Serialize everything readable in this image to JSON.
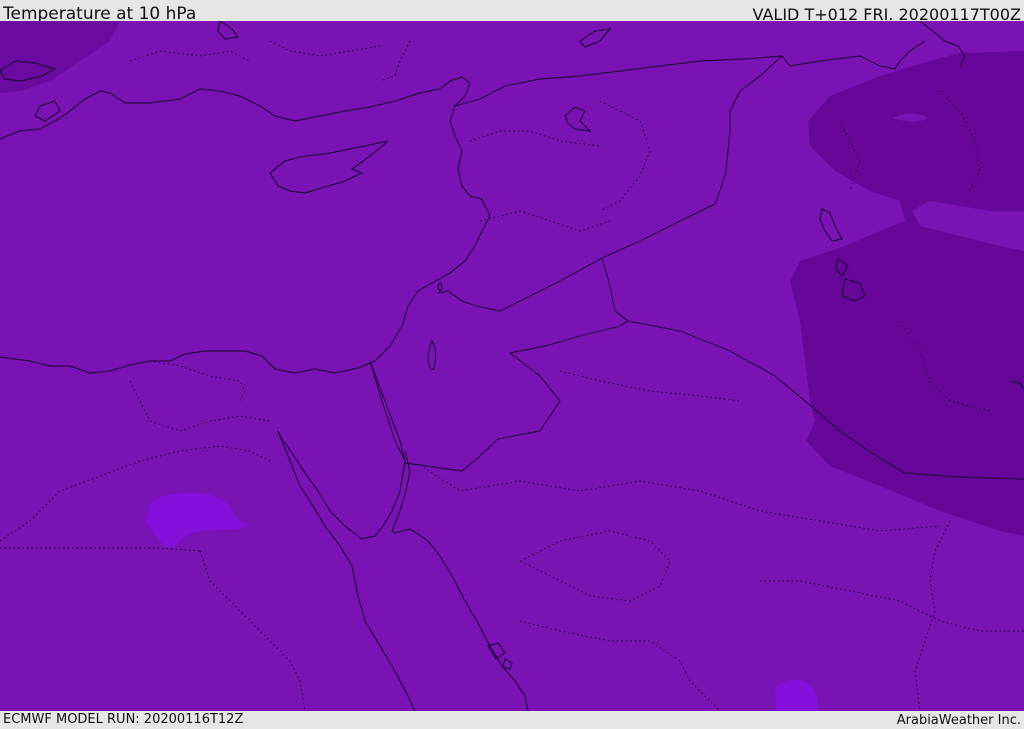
{
  "header": {
    "title": "Temperature at 10 hPa",
    "valid_time": "VALID T+012 FRI. 20200117T00Z"
  },
  "footer": {
    "model_run": "ECMWF MODEL RUN: 20200116T12Z",
    "credit": "ArabiaWeather Inc."
  },
  "map": {
    "field": "temperature",
    "level": "10 hPa",
    "colors": {
      "base": "#7a13b4",
      "cold_region": "#66079a",
      "warm_patch": "#8410dc",
      "coastline": "#1a0030"
    }
  }
}
